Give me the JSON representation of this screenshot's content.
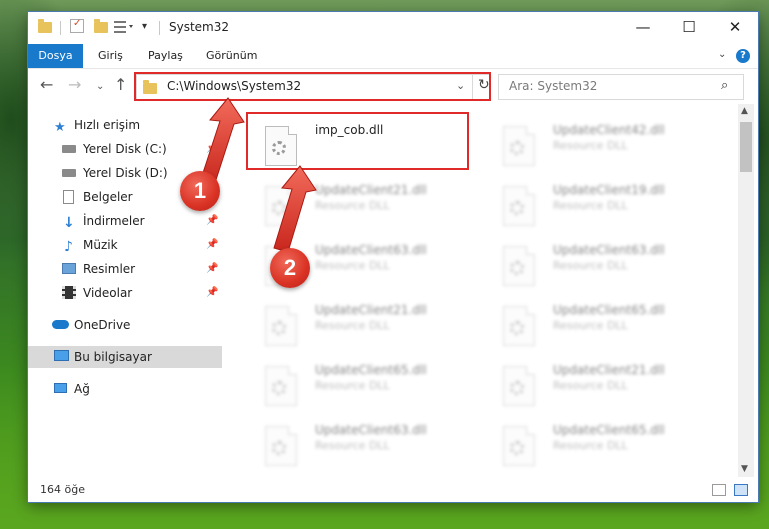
{
  "window": {
    "title": "System32",
    "minimize": "—",
    "maximize": "☐",
    "close": "✕"
  },
  "ribbon": {
    "tabs": [
      "Dosya",
      "Giriş",
      "Paylaş",
      "Görünüm"
    ],
    "help": "?"
  },
  "address": {
    "path": "C:\\Windows\\System32"
  },
  "search": {
    "placeholder": "Ara: System32"
  },
  "sidebar": {
    "quick_access": "Hızlı erişim",
    "items": [
      {
        "label": "Yerel Disk (C:)",
        "pinned": true
      },
      {
        "label": "Yerel Disk (D:)",
        "pinned": true
      },
      {
        "label": "Belgeler",
        "pinned": true
      },
      {
        "label": "İndirmeler",
        "pinned": true
      },
      {
        "label": "Müzik",
        "pinned": true
      },
      {
        "label": "Resimler",
        "pinned": true
      },
      {
        "label": "Videolar",
        "pinned": true
      }
    ],
    "onedrive": "OneDrive",
    "this_pc": "Bu bilgisayar",
    "network": "Ağ"
  },
  "files": {
    "main": {
      "name": "imp_cob.dll",
      "type": ""
    },
    "blurred": [
      {
        "name": "UpdateClient42.dll",
        "type": "Resource DLL"
      },
      {
        "name": "UpdateClient21.dll",
        "type": "Resource DLL"
      },
      {
        "name": "UpdateClient19.dll",
        "type": "Resource DLL"
      },
      {
        "name": "UpdateClient63.dll",
        "type": "Resource DLL"
      },
      {
        "name": "UpdateClient63.dll",
        "type": "Resource DLL"
      },
      {
        "name": "UpdateClient21.dll",
        "type": "Resource DLL"
      },
      {
        "name": "UpdateClient65.dll",
        "type": "Resource DLL"
      },
      {
        "name": "UpdateClient65.dll",
        "type": "Resource DLL"
      },
      {
        "name": "UpdateClient21.dll",
        "type": "Resource DLL"
      },
      {
        "name": "UpdateClient63.dll",
        "type": "Resource DLL"
      },
      {
        "name": "UpdateClient65.dll",
        "type": "Resource DLL"
      }
    ]
  },
  "status": {
    "item_count": "164 öğe"
  },
  "annotations": {
    "step1": "1",
    "step2": "2",
    "color": "#e02a2a"
  }
}
